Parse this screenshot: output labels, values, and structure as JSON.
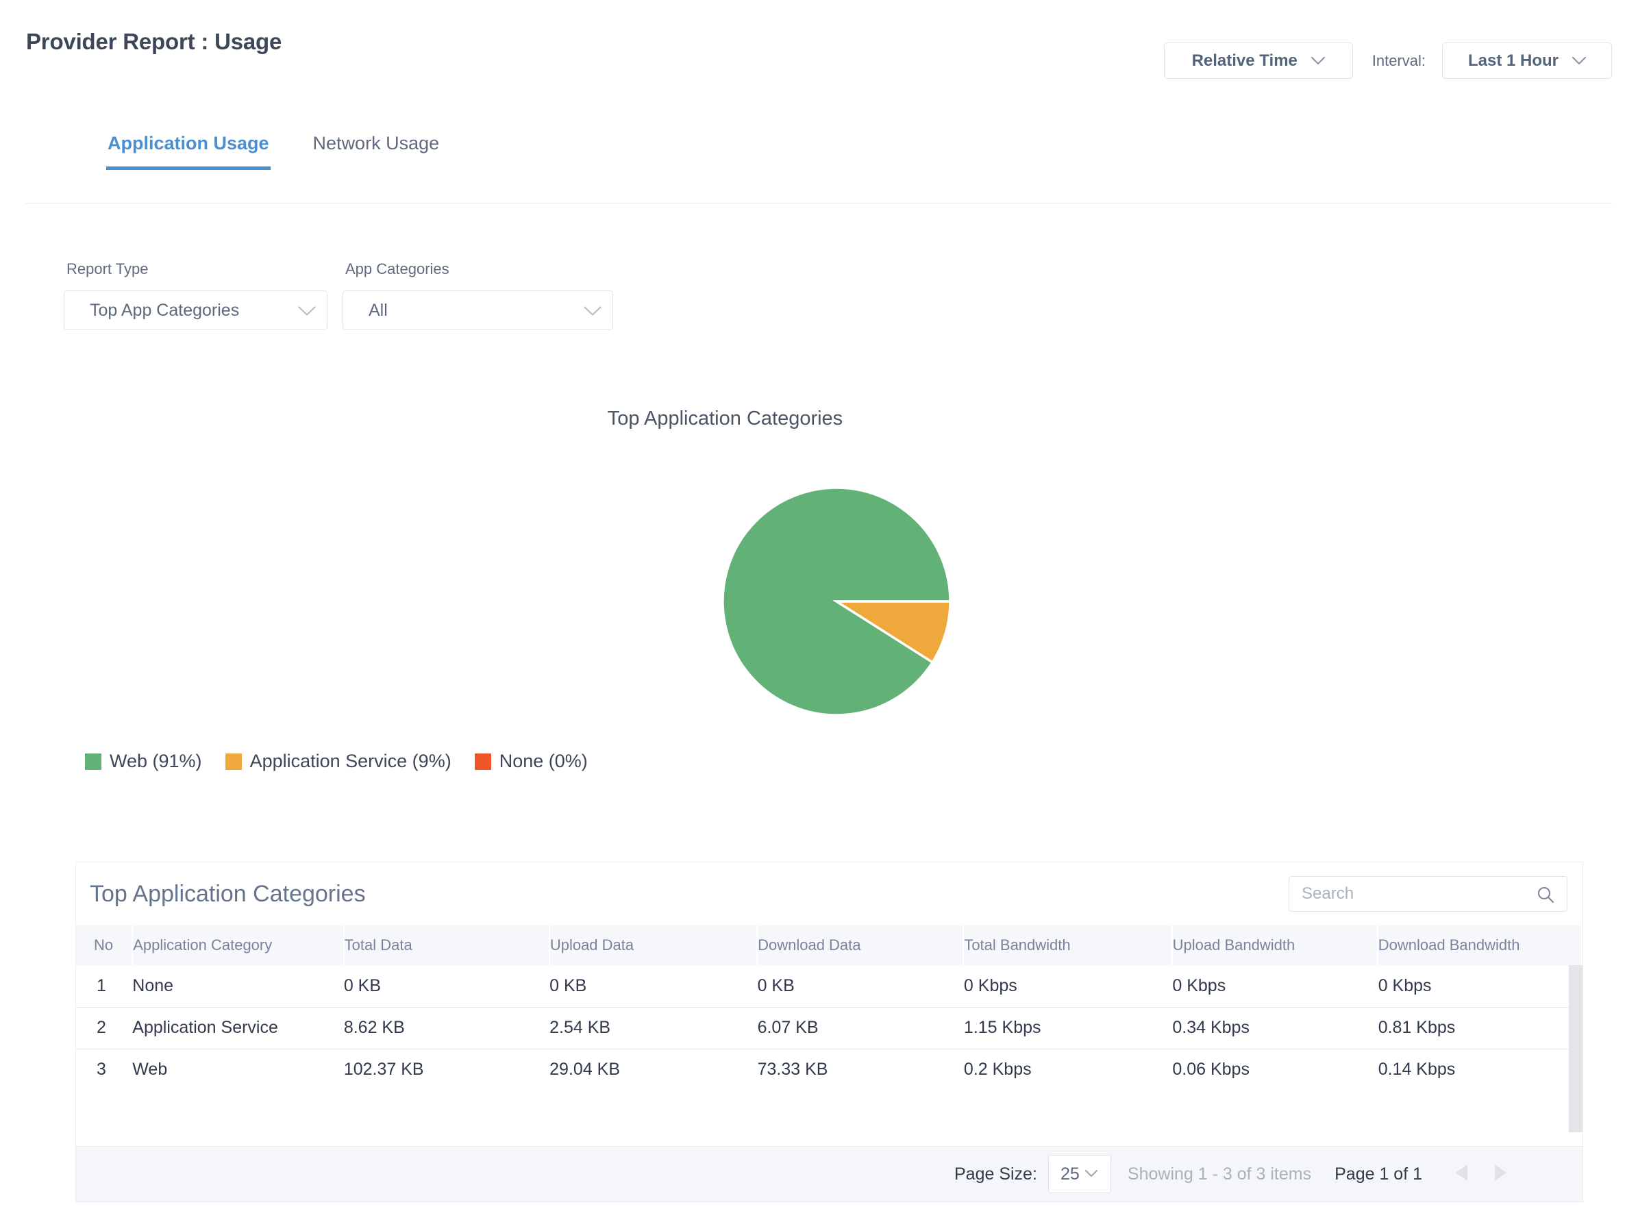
{
  "header": {
    "title": "Provider Report : Usage",
    "relative_time_label": "Relative Time",
    "interval_label": "Interval:",
    "interval_value": "Last 1 Hour"
  },
  "tabs": [
    {
      "label": "Application Usage",
      "active": true
    },
    {
      "label": "Network Usage",
      "active": false
    }
  ],
  "filters": {
    "report_type": {
      "label": "Report Type",
      "value": "Top App Categories"
    },
    "app_categories": {
      "label": "App Categories",
      "value": "All"
    }
  },
  "chart_data": {
    "type": "pie",
    "title": "Top Application Categories",
    "categories": [
      "Web",
      "Application Service",
      "None"
    ],
    "values": [
      91,
      9,
      0
    ],
    "colors": [
      "#62b177",
      "#efa83c",
      "#ef5528"
    ],
    "legend": [
      {
        "label": "Web (91%)",
        "color": "#62b177"
      },
      {
        "label": "Application Service (9%)",
        "color": "#efa83c"
      },
      {
        "label": "None (0%)",
        "color": "#ef5528"
      }
    ],
    "legend_position": "bottom-left",
    "start_angle": 0,
    "direction": "clockwise",
    "units": "percent"
  },
  "table": {
    "caption": "Top Application Categories",
    "search_placeholder": "Search",
    "search_value": "",
    "columns": [
      "No",
      "Application Category",
      "Total Data",
      "Upload Data",
      "Download Data",
      "Total Bandwidth",
      "Upload Bandwidth",
      "Download Bandwidth"
    ],
    "rows": [
      {
        "no": "1",
        "category": "None",
        "total_data": "0 KB",
        "upload_data": "0 KB",
        "download_data": "0 KB",
        "total_bw": "0 Kbps",
        "upload_bw": "0 Kbps",
        "download_bw": "0 Kbps"
      },
      {
        "no": "2",
        "category": "Application Service",
        "total_data": "8.62 KB",
        "upload_data": "2.54 KB",
        "download_data": "6.07 KB",
        "total_bw": "1.15 Kbps",
        "upload_bw": "0.34 Kbps",
        "download_bw": "0.81 Kbps"
      },
      {
        "no": "3",
        "category": "Web",
        "total_data": "102.37 KB",
        "upload_data": "29.04 KB",
        "download_data": "73.33 KB",
        "total_bw": "0.2 Kbps",
        "upload_bw": "0.06 Kbps",
        "download_bw": "0.14 Kbps"
      }
    ]
  },
  "pagination": {
    "page_size_label": "Page Size:",
    "page_size_value": "25",
    "showing": "Showing 1 - 3 of 3 items",
    "page_of": "Page 1 of 1"
  }
}
